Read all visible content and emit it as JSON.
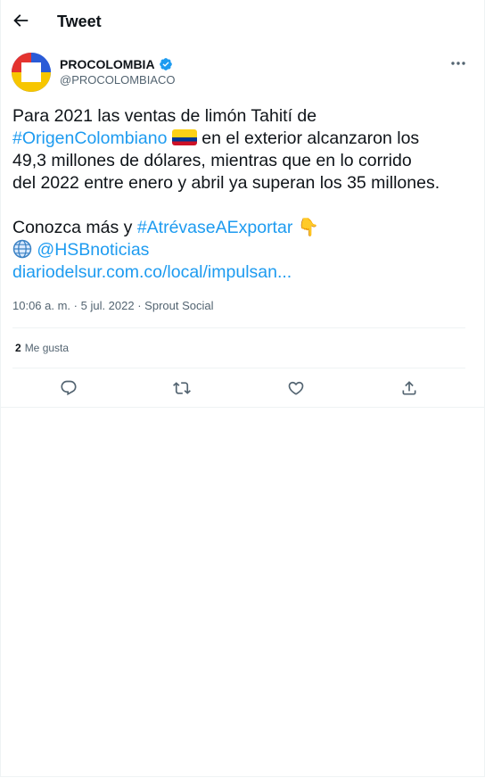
{
  "header": {
    "title": "Tweet"
  },
  "author": {
    "name": "PROCOLOMBIA",
    "handle": "@PROCOLOMBIACO"
  },
  "tweet": {
    "line1": "Para 2021 las ventas de limón Tahití de",
    "hashtag1": "#OrigenColombiano",
    "line2_rest": " en el exterior alcanzaron los",
    "line3": "49,3 millones de dólares, mientras que en lo corrido",
    "line4": "del 2022 entre enero y abril ya superan los 35 millones.",
    "line6_start": "Conozca más y ",
    "hashtag2": "#AtrévaseAExportar",
    "mention": "@HSBnoticias",
    "url": "diariodelsur.com.co/local/impulsan..."
  },
  "meta": {
    "time": "10:06 a. m.",
    "date": "5 jul. 2022",
    "source": "Sprout Social"
  },
  "engagement": {
    "likes_count": "2",
    "likes_label": "Me gusta"
  },
  "colors": {
    "accent": "#1d9bf0",
    "text": "#0f1419",
    "muted": "#536471"
  }
}
